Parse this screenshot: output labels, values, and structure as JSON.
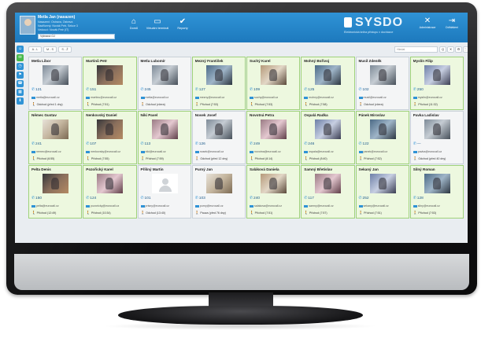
{
  "header": {
    "user": {
      "name": "Metla Jan (nasazen)",
      "line1": "Nasazení: Ostrava, Ostrava",
      "line2": "Nadřízený: Novák Petr, Sekce 3",
      "line3": "Vedoucí: Novák Petr (IT)",
      "select_value": "Vybraná OJ"
    },
    "nav": [
      {
        "icon": "⌂",
        "label": "Domů"
      },
      {
        "icon": "▭",
        "label": "Virtuální terminál"
      },
      {
        "icon": "✔",
        "label": "Reporty"
      }
    ],
    "brand": {
      "name": "SYSDO",
      "subtitle": "Elektronická kniha přístupu v docházce"
    },
    "right_nav": [
      {
        "icon": "✕",
        "label": "Administrace"
      },
      {
        "icon": "⇥",
        "label": "Odhlášení"
      }
    ]
  },
  "toolbar": {
    "filters": [
      "A - L",
      "M - S",
      "S - Ž"
    ],
    "search_placeholder": "Hledat",
    "tools": [
      "Q",
      "✕",
      "⚙",
      "⋮⋮"
    ]
  },
  "rail": [
    "☺",
    "✉",
    "◷",
    "⚑",
    "☎",
    "▦",
    "⬇"
  ],
  "employees": [
    {
      "name": "Metla Libor",
      "phone": "121",
      "email": "metla@eurocall.cz",
      "status": "Odchod (před 1 dny)",
      "present": false,
      "photo": "p0"
    },
    {
      "name": "Martinů Petr",
      "phone": "151",
      "email": "martinu@eurocall.cz",
      "status": "Příchod (7:51)",
      "present": true,
      "photo": "p4"
    },
    {
      "name": "Metla Lubomír",
      "phone": "245",
      "email": "metla@eurocall.cz",
      "status": "Odchod (včera)",
      "present": false,
      "photo": "p0"
    },
    {
      "name": "Mezný František",
      "phone": "127",
      "email": "mezny@eurocall.cz",
      "status": "Příchod (7:53)",
      "present": true,
      "photo": "p2"
    },
    {
      "name": "Suchý Karel",
      "phone": "109",
      "email": "suchy@eurocall.cz",
      "status": "Příchod (7:53)",
      "present": true,
      "photo": "p1"
    },
    {
      "name": "Mohný Bořivoj",
      "phone": "125",
      "email": "mohny@eurocall.cz",
      "status": "Příchod (7:58)",
      "present": true,
      "photo": "p2"
    },
    {
      "name": "Musil Zdeněk",
      "phone": "102",
      "email": "musil@eurocall.cz",
      "status": "Odchod (včera)",
      "present": false,
      "photo": "p0"
    },
    {
      "name": "Myslín Filip",
      "phone": "250",
      "email": "myslin@eurocall.cz",
      "status": "Příchod (11:32)",
      "present": true,
      "photo": "p5"
    },
    {
      "name": "Němec Gustav",
      "phone": "241",
      "email": "nemec@eurocall.cz",
      "status": "Příchod (6:55)",
      "present": true,
      "photo": "p3"
    },
    {
      "name": "Nenkovský Daniel",
      "phone": "107",
      "email": "nenkovsky@eurocall.cz",
      "status": "Příchod (7:55)",
      "present": true,
      "photo": "p4"
    },
    {
      "name": "Niki Pavel",
      "phone": "113",
      "email": "niki@eurocall.cz",
      "status": "Příchod (7:59)",
      "present": true,
      "photo": "p6"
    },
    {
      "name": "Nosek Josef",
      "phone": "126",
      "email": "nosek@eurocall.cz",
      "status": "Odchod (před 12 dny)",
      "present": false,
      "photo": "p0"
    },
    {
      "name": "Novotná Petra",
      "phone": "249",
      "email": "novotna@eurocall.cz",
      "status": "Příchod (8:14)",
      "present": true,
      "photo": "p6"
    },
    {
      "name": "Ospalá Radka",
      "phone": "246",
      "email": "ospala@eurocall.cz",
      "status": "Příchod (8:40)",
      "present": true,
      "photo": "p5"
    },
    {
      "name": "Pánek Miroslav",
      "phone": "122",
      "email": "panek@eurocall.cz",
      "status": "Příchod (7:52)",
      "present": true,
      "photo": "p2"
    },
    {
      "name": "Pavka Ladislav",
      "phone": "—",
      "email": "pavka@eurocall.cz",
      "status": "Odchod (před 40 dny)",
      "present": false,
      "photo": "p0"
    },
    {
      "name": "Pelta Denis",
      "phone": "150",
      "email": "pelta@eurocall.cz",
      "status": "Příchod (12:49)",
      "present": true,
      "photo": "p4"
    },
    {
      "name": "Pozořický Karel",
      "phone": "124",
      "email": "pozoricky@eurocall.cz",
      "status": "Příchod (10:34)",
      "present": true,
      "photo": "p6"
    },
    {
      "name": "Příšný Martin",
      "phone": "101",
      "email": "prisny@eurocall.cz",
      "status": "Odchod (13:40)",
      "present": false,
      "photo": "blank"
    },
    {
      "name": "Purný Jan",
      "phone": "103",
      "email": "purny@eurocall.cz",
      "status": "Pauza (před 76 dny)",
      "present": false,
      "photo": "p3"
    },
    {
      "name": "Saláková Daniela",
      "phone": "240",
      "email": "salakova@eurocall.cz",
      "status": "Příchod (7:51)",
      "present": true,
      "photo": "p1"
    },
    {
      "name": "Samný Břetislav",
      "phone": "117",
      "email": "samny@eurocall.cz",
      "status": "Příchod (7:57)",
      "present": true,
      "photo": "p6"
    },
    {
      "name": "Sekaný Jan",
      "phone": "252",
      "email": "sekany@eurocall.cz",
      "status": "Příchod (7:51)",
      "present": true,
      "photo": "p5"
    },
    {
      "name": "Silný Roman",
      "phone": "128",
      "email": "silny@eurocall.cz",
      "status": "Příchod (7:53)",
      "present": true,
      "photo": "p2"
    }
  ]
}
